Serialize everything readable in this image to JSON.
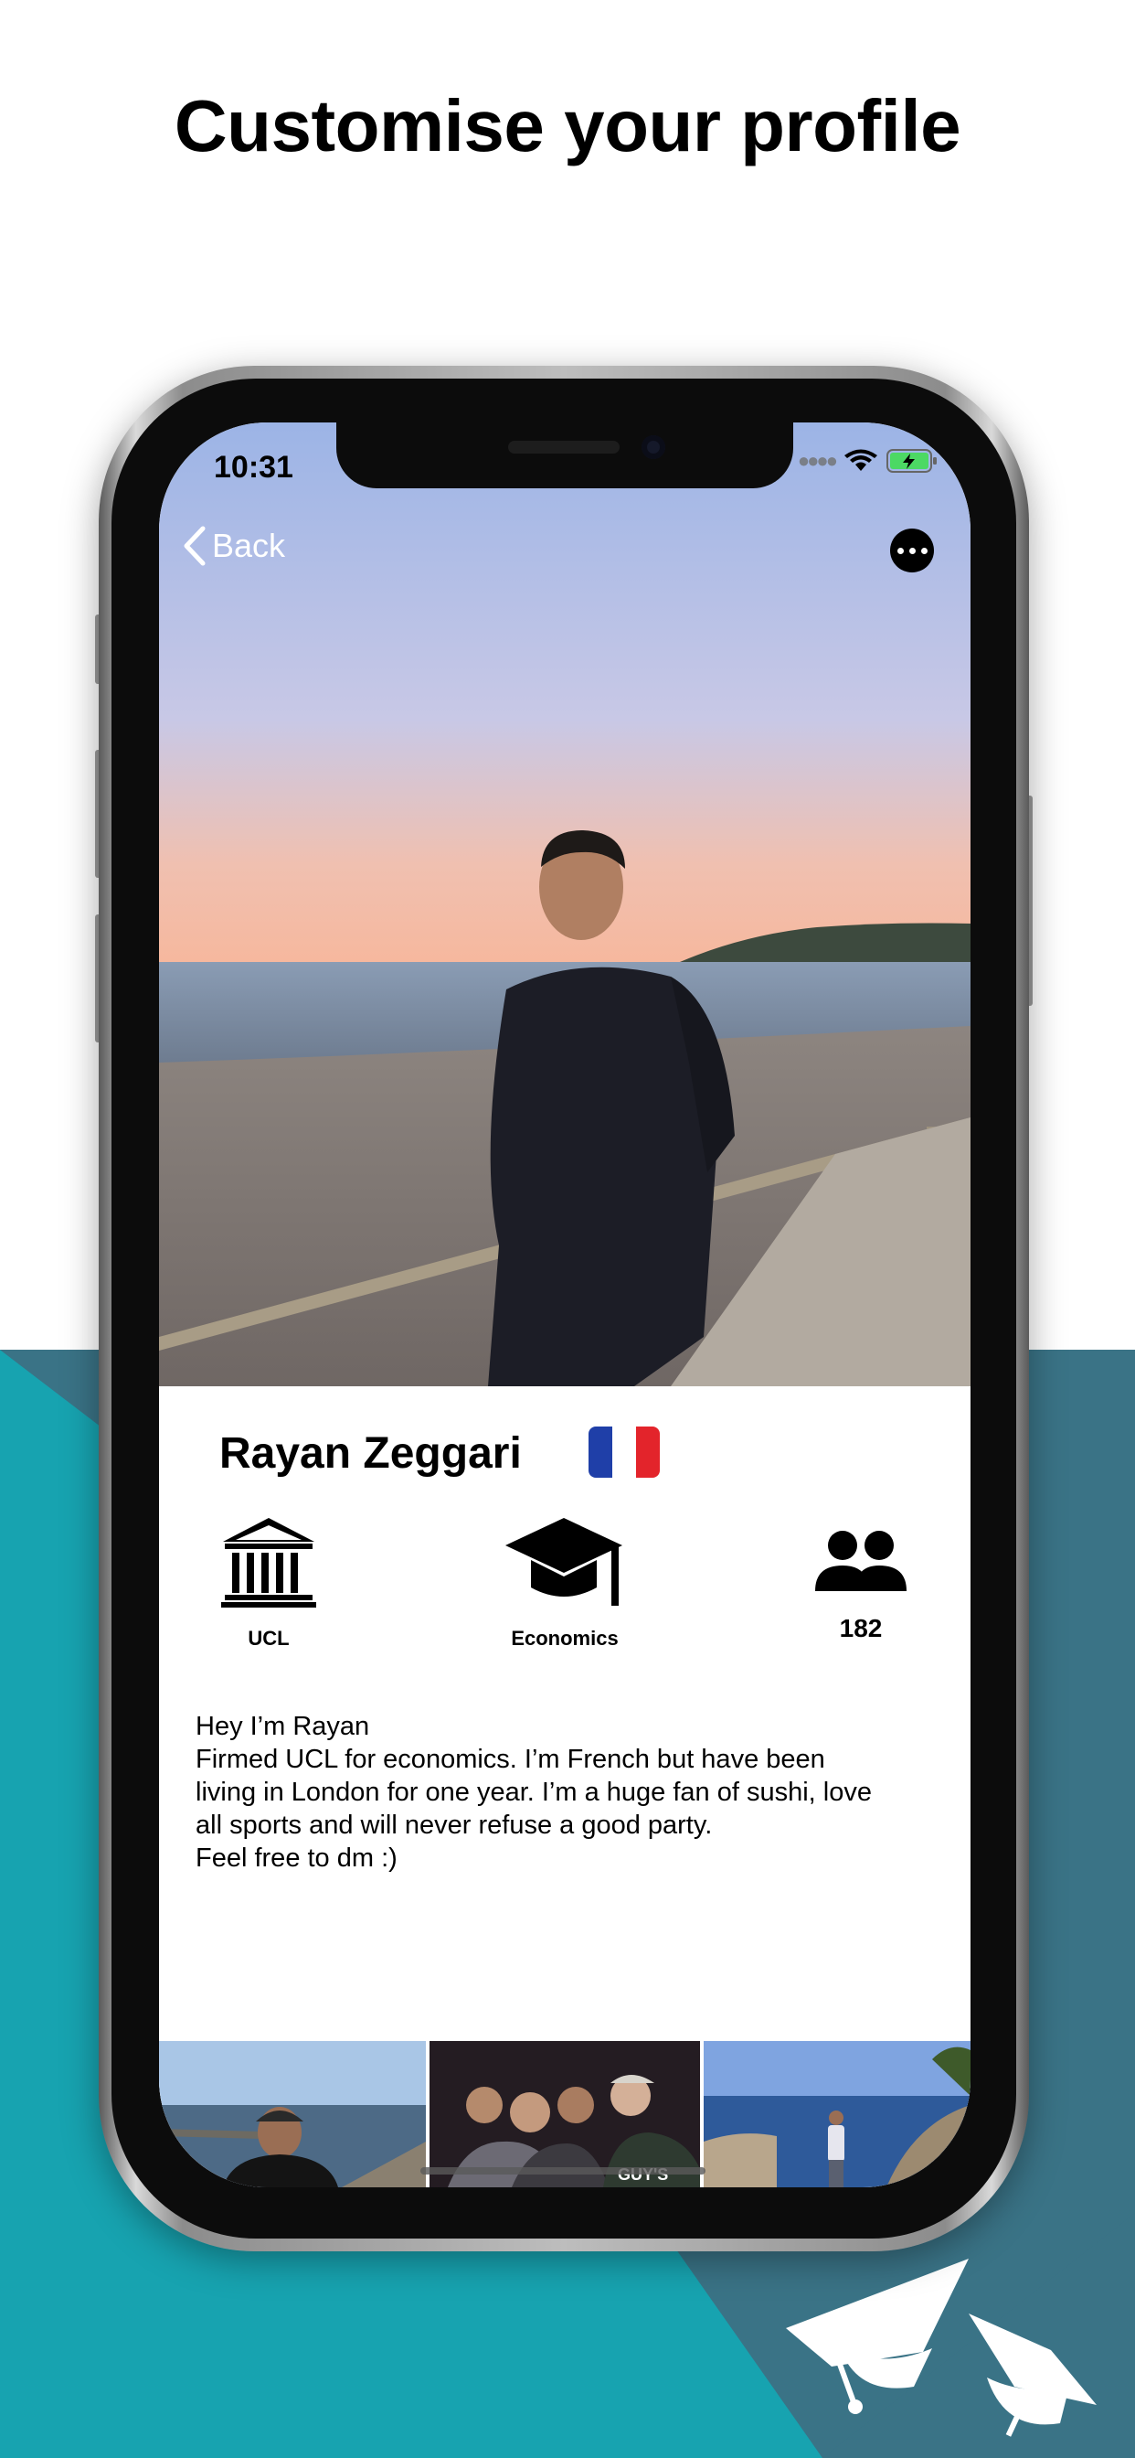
{
  "headline": "Customise your profile",
  "colors": {
    "teal_dark": "#3a7386",
    "teal_light": "#17a3b0",
    "white": "#ffffff",
    "black": "#000000"
  },
  "status_bar": {
    "time": "10:31",
    "icons": [
      "cellular-dots-icon",
      "wifi-icon",
      "battery-charging-icon"
    ]
  },
  "nav": {
    "back_label": "Back",
    "back_icon": "chevron-left-icon",
    "more_icon": "ellipsis-icon"
  },
  "profile": {
    "name": "Rayan Zeggari",
    "flag": "france-flag-icon",
    "stats": [
      {
        "icon": "university-icon",
        "label": "UCL"
      },
      {
        "icon": "graduation-cap-icon",
        "label": "Economics"
      },
      {
        "icon": "people-icon",
        "label": "182"
      }
    ],
    "bio": [
      "Hey I’m Rayan",
      "Firmed UCL for economics. I’m French but have been",
      "living in London for one year. I’m a huge fan of sushi, love",
      "all sports and will never refuse a good party.",
      "Feel free to dm :)"
    ]
  },
  "gallery": {
    "photos": [
      "beach-selfie-photo",
      "group-party-photo",
      "seaside-rocks-photo"
    ],
    "sign_text": "GUY'S"
  },
  "decor": {
    "icons": [
      "graduation-cap-icon",
      "graduation-cap-icon"
    ]
  }
}
